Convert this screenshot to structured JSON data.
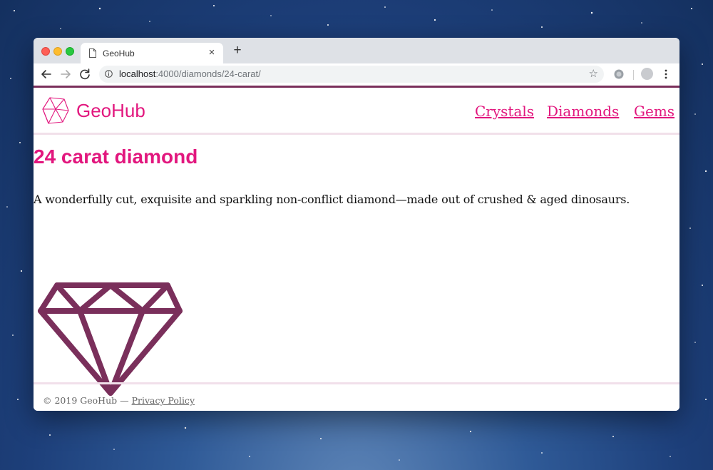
{
  "browser": {
    "tab_title": "GeoHub",
    "close_glyph": "×",
    "new_tab_glyph": "+",
    "url_host": "localhost",
    "url_path": ":4000/diamonds/24-carat/",
    "bookmark_glyph": "☆"
  },
  "site": {
    "logo_text": "GeoHub",
    "nav": [
      {
        "label": "Crystals"
      },
      {
        "label": "Diamonds"
      },
      {
        "label": "Gems"
      }
    ]
  },
  "product": {
    "title": "24 carat diamond",
    "description": "A wonderfully cut, exquisite and sparkling non-conflict diamond—made out of crushed & aged dinosaurs."
  },
  "footer": {
    "copyright": "© 2019 GeoHub — ",
    "privacy_label": "Privacy Policy"
  },
  "colors": {
    "brand_pink": "#e2177e",
    "brand_plum": "#7a2f5b"
  }
}
